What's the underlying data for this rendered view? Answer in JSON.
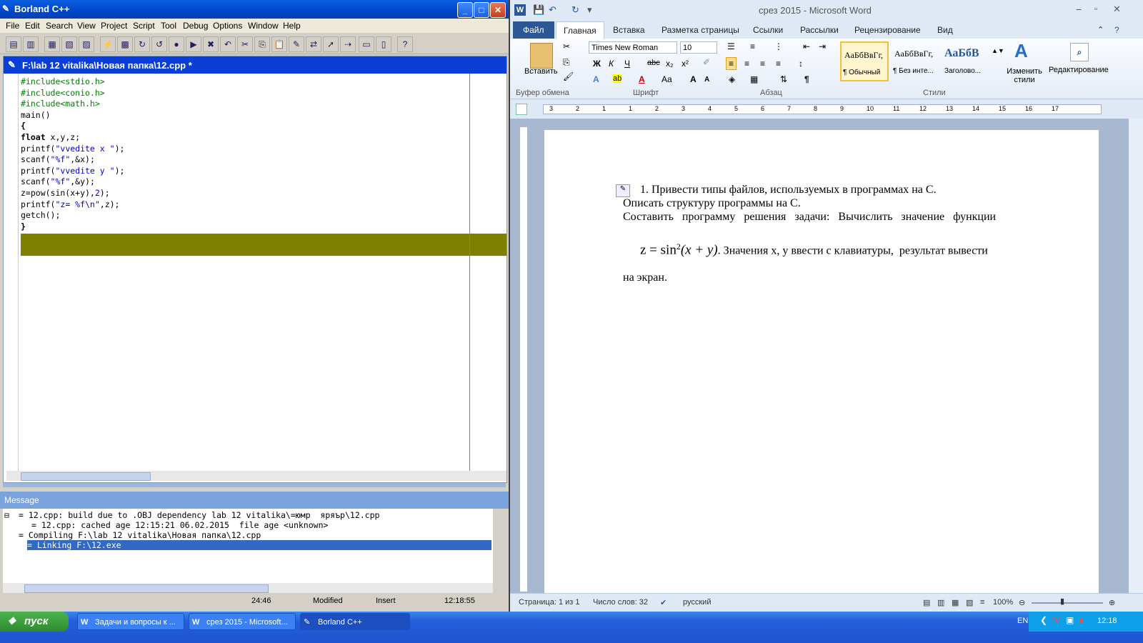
{
  "borland": {
    "title": "Borland C++",
    "menu": [
      "File",
      "Edit",
      "Search",
      "View",
      "Project",
      "Script",
      "Tool",
      "Debug",
      "Options",
      "Window",
      "Help"
    ],
    "doc_title": "F:\\lab 12 vitalika\\Новая папка\\12.cpp *",
    "code": [
      {
        "t": "#include<stdio.h>",
        "c": "pp"
      },
      {
        "t": "#include<conio.h>",
        "c": "pp"
      },
      {
        "t": "#include<math.h>",
        "c": "pp"
      },
      {
        "t": "main()",
        "c": ""
      },
      {
        "t": "{",
        "c": "kw"
      },
      {
        "t": "float x,y,z;",
        "c": "mixed_float"
      },
      {
        "t": "printf(\"vvedite x \");",
        "c": "mixed_str"
      },
      {
        "t": "scanf(\"%f\",&x);",
        "c": "mixed_str"
      },
      {
        "t": "printf(\"vvedite y \");",
        "c": "mixed_str"
      },
      {
        "t": "scanf(\"%f\",&y);",
        "c": "mixed_str"
      },
      {
        "t": "z=pow(sin(x+y),2);",
        "c": "mixed_num"
      },
      {
        "t": "printf(\"z= %f\\n\",z);",
        "c": "mixed_str"
      },
      {
        "t": "getch();",
        "c": ""
      },
      {
        "t": "}",
        "c": "kw"
      }
    ],
    "message_title": "Message",
    "messages": [
      "= 12.cpp: build due to .OBJ dependency lab 12 vitalika\\=юмр  яряър\\12.cpp",
      "= 12.cpp: cached age 12:15:21 06.02.2015  file age <unknown>",
      "= Compiling F:\\lab 12 vitalika\\Новая папка\\12.cpp",
      "= Linking F:\\12.exe"
    ],
    "status": {
      "pos": "24:46",
      "mod": "Modified",
      "mode": "Insert",
      "time": "12:18:55"
    }
  },
  "word": {
    "title": "срез 2015  -  Microsoft Word",
    "tabs": [
      "Файл",
      "Главная",
      "Вставка",
      "Разметка страницы",
      "Ссылки",
      "Рассылки",
      "Рецензирование",
      "Вид"
    ],
    "font_name": "Times New Roman",
    "font_size": "10",
    "paste_label": "Вставить",
    "groups": [
      "Буфер обмена",
      "Шрифт",
      "Абзац",
      "Стили"
    ],
    "styles": [
      {
        "sample": "АаБбВвГг,",
        "name": "¶ Обычный"
      },
      {
        "sample": "АаБбВвГг,",
        "name": "¶ Без инте..."
      },
      {
        "sample": "АаБбВ",
        "name": "Заголово..."
      }
    ],
    "change_styles": "Изменить стили",
    "editing": "Редактирование",
    "ruler_nums": [
      "3",
      "2",
      "1",
      "1",
      "2",
      "3",
      "4",
      "5",
      "6",
      "7",
      "8",
      "9",
      "10",
      "11",
      "12",
      "13",
      "14",
      "15",
      "16",
      "17"
    ],
    "doc": {
      "line1": "1.  Привести типы файлов, используемых в программах на С.",
      "line2": "Описать структуру программы на С.",
      "line3": "Составить   программу   решения   задачи:   Вычислить   значение   функции",
      "formula_z": "z = sin",
      "formula_exp": "2",
      "formula_arg": "(x + y)",
      "line4": ". Значения x, у ввести с клавиатуры,  результат вывести",
      "line5": "на экран."
    },
    "status": {
      "page": "Страница: 1 из 1",
      "words": "Число слов: 32",
      "lang": "русский",
      "zoom": "100%"
    }
  },
  "taskbar": {
    "start": "пуск",
    "tasks": [
      "Задачи и вопросы к ...",
      "срез 2015 - Microsoft...",
      "Borland C++"
    ],
    "lang": "EN",
    "clock": "12:18"
  }
}
